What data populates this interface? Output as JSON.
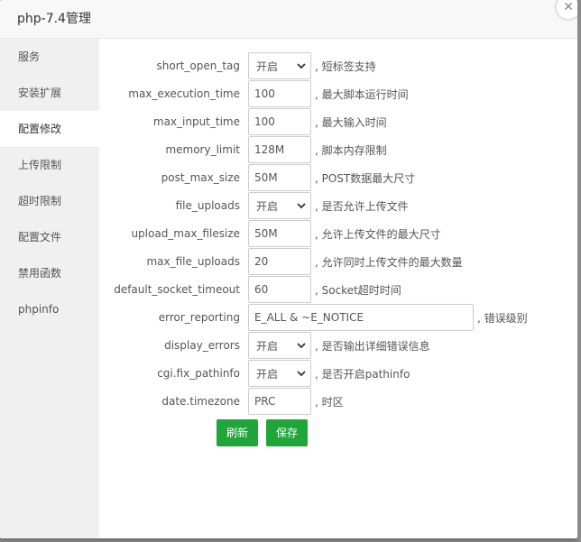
{
  "window": {
    "title": "php-7.4管理",
    "close_symbol": "✕"
  },
  "sidebar": {
    "items": [
      {
        "label": "服务"
      },
      {
        "label": "安装扩展"
      },
      {
        "label": "配置修改"
      },
      {
        "label": "上传限制"
      },
      {
        "label": "超时限制"
      },
      {
        "label": "配置文件"
      },
      {
        "label": "禁用函数"
      },
      {
        "label": "phpinfo"
      }
    ],
    "active": "配置修改"
  },
  "config": {
    "rows": [
      {
        "label": "short_open_tag",
        "type": "select",
        "value": "开启",
        "desc": ", 短标签支持"
      },
      {
        "label": "max_execution_time",
        "type": "input",
        "value": "100",
        "desc": ", 最大脚本运行时间"
      },
      {
        "label": "max_input_time",
        "type": "input",
        "value": "100",
        "desc": ", 最大输入时间"
      },
      {
        "label": "memory_limit",
        "type": "input",
        "value": "128M",
        "desc": ", 脚本内存限制"
      },
      {
        "label": "post_max_size",
        "type": "input",
        "value": "50M",
        "desc": ", POST数据最大尺寸"
      },
      {
        "label": "file_uploads",
        "type": "select",
        "value": "开启",
        "desc": ", 是否允许上传文件"
      },
      {
        "label": "upload_max_filesize",
        "type": "input",
        "value": "50M",
        "desc": ", 允许上传文件的最大尺寸"
      },
      {
        "label": "max_file_uploads",
        "type": "input",
        "value": "20",
        "desc": ", 允许同时上传文件的最大数量"
      },
      {
        "label": "default_socket_timeout",
        "type": "input",
        "value": "60",
        "desc": ", Socket超时时间"
      },
      {
        "label": "error_reporting",
        "type": "input",
        "value": "E_ALL & ~E_NOTICE",
        "desc": ", 错误级别"
      },
      {
        "label": "display_errors",
        "type": "select",
        "value": "开启",
        "desc": ", 是否输出详细错误信息"
      },
      {
        "label": "cgi.fix_pathinfo",
        "type": "select",
        "value": "开启",
        "desc": ", 是否开启pathinfo"
      },
      {
        "label": "date.timezone",
        "type": "input",
        "value": "PRC",
        "desc": ", 时区"
      }
    ]
  },
  "actions": {
    "refresh_label": "刷新",
    "save_label": "保存"
  },
  "colors": {
    "accent": "#20a53a",
    "sidebar_bg": "#f0f0f0",
    "text": "#555555"
  }
}
